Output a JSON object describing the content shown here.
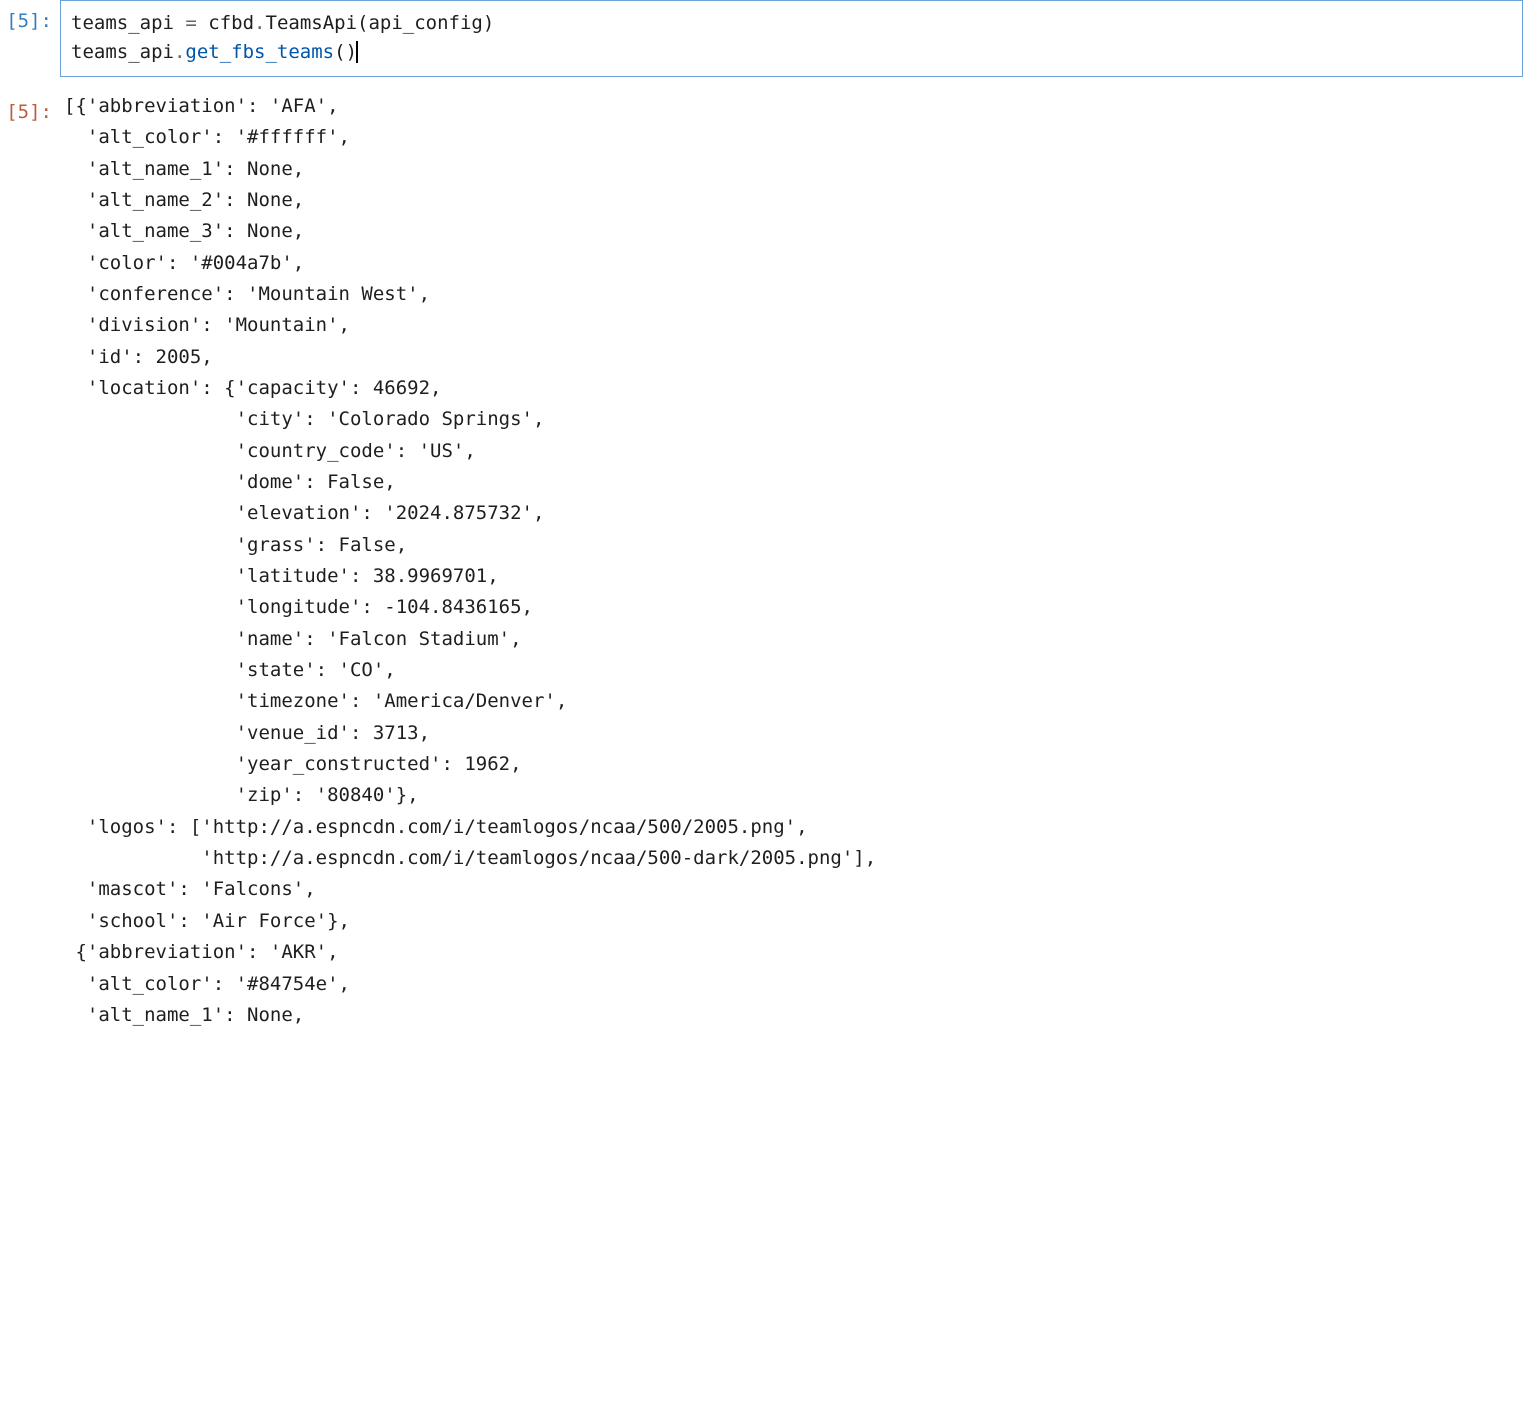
{
  "input_prompt": "[5]:",
  "output_prompt": "[5]:",
  "code_line_1": {
    "var": "teams_api",
    "assign": " = ",
    "mod": "cfbd",
    "dot": ".",
    "call": "TeamsApi",
    "open": "(",
    "arg": "api_config",
    "close": ")"
  },
  "code_line_2": {
    "obj": "teams_api",
    "dot": ".",
    "method": "get_fbs_teams",
    "open": "(",
    "close": ")"
  },
  "output_text": "[{'abbreviation': 'AFA',\n  'alt_color': '#ffffff',\n  'alt_name_1': None,\n  'alt_name_2': None,\n  'alt_name_3': None,\n  'color': '#004a7b',\n  'conference': 'Mountain West',\n  'division': 'Mountain',\n  'id': 2005,\n  'location': {'capacity': 46692,\n               'city': 'Colorado Springs',\n               'country_code': 'US',\n               'dome': False,\n               'elevation': '2024.875732',\n               'grass': False,\n               'latitude': 38.9969701,\n               'longitude': -104.8436165,\n               'name': 'Falcon Stadium',\n               'state': 'CO',\n               'timezone': 'America/Denver',\n               'venue_id': 3713,\n               'year_constructed': 1962,\n               'zip': '80840'},\n  'logos': ['http://a.espncdn.com/i/teamlogos/ncaa/500/2005.png',\n            'http://a.espncdn.com/i/teamlogos/ncaa/500-dark/2005.png'],\n  'mascot': 'Falcons',\n  'school': 'Air Force'},\n {'abbreviation': 'AKR',\n  'alt_color': '#84754e',\n  'alt_name_1': None,"
}
